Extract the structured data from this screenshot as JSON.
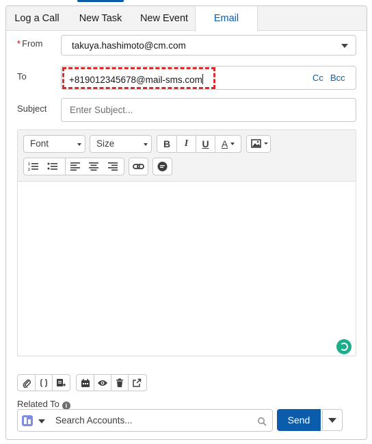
{
  "tabs": [
    {
      "label": "Log a Call"
    },
    {
      "label": "New Task"
    },
    {
      "label": "New Event"
    },
    {
      "label": "Email",
      "active": true
    }
  ],
  "form": {
    "from_label": "From",
    "from_value": "takuya.hashimoto@cm.com",
    "to_label": "To",
    "to_value": "+819012345678@mail-sms.com",
    "cc_label": "Cc",
    "bcc_label": "Bcc",
    "subject_label": "Subject",
    "subject_placeholder": "Enter Subject...",
    "required_marker": "*"
  },
  "editor": {
    "font_label": "Font",
    "size_label": "Size",
    "bold": "B",
    "italic": "I",
    "underline": "U",
    "text_color": "A"
  },
  "related": {
    "label": "Related To",
    "info": "i",
    "placeholder": "Search Accounts..."
  },
  "actions": {
    "send_label": "Send"
  },
  "colors": {
    "brand": "#0b5cab",
    "required": "#ba0517",
    "highlight_border": "#d92b2b",
    "spinner": "#1bae8a"
  }
}
